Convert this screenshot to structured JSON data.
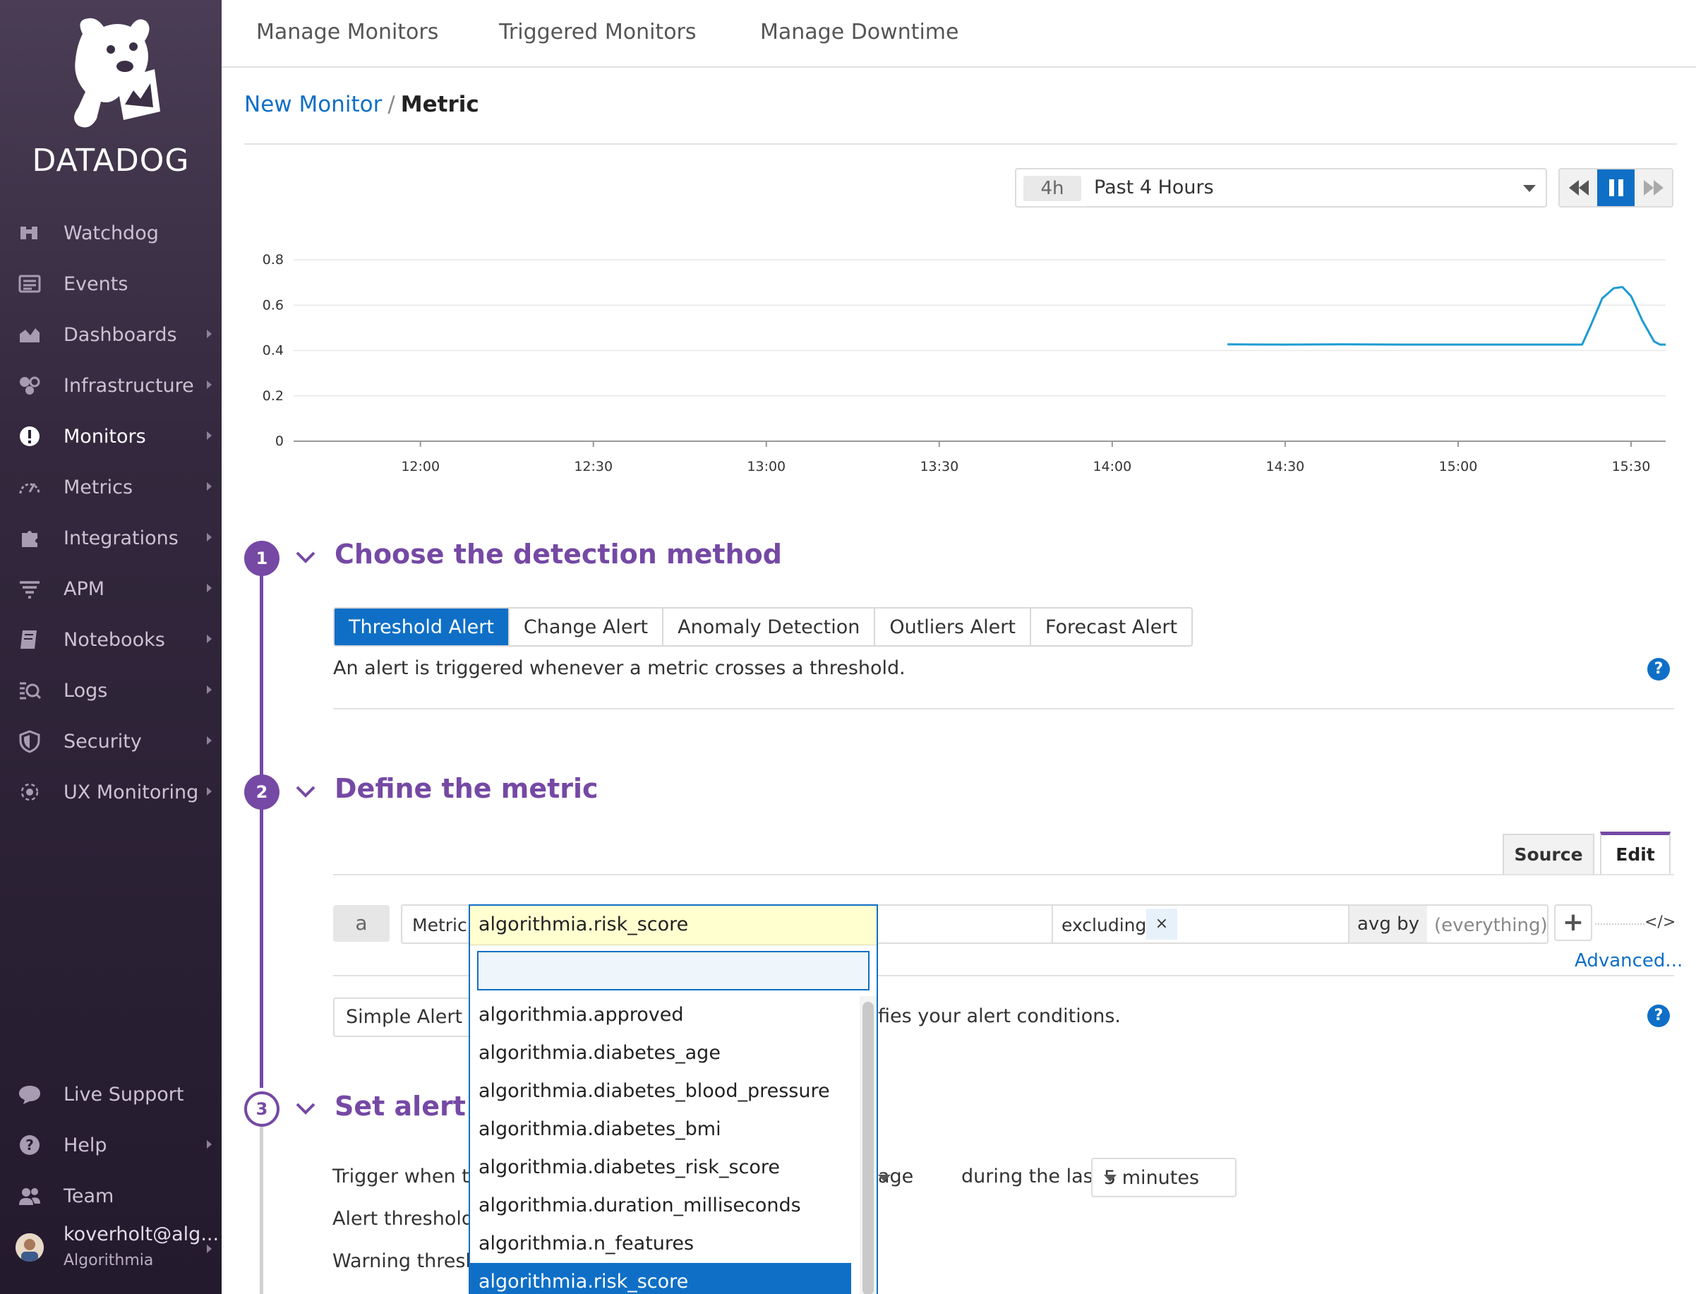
{
  "sidebar": {
    "logo_text": "DATADOG",
    "items": [
      {
        "label": "Watchdog",
        "icon": "binoculars-icon",
        "has_submenu": false,
        "active": false
      },
      {
        "label": "Events",
        "icon": "list-icon",
        "has_submenu": false,
        "active": false
      },
      {
        "label": "Dashboards",
        "icon": "area-chart-icon",
        "has_submenu": true,
        "active": false
      },
      {
        "label": "Infrastructure",
        "icon": "hexagons-icon",
        "has_submenu": true,
        "active": false
      },
      {
        "label": "Monitors",
        "icon": "exclamation-circle-icon",
        "has_submenu": true,
        "active": true
      },
      {
        "label": "Metrics",
        "icon": "gauge-icon",
        "has_submenu": true,
        "active": false
      },
      {
        "label": "Integrations",
        "icon": "puzzle-icon",
        "has_submenu": true,
        "active": false
      },
      {
        "label": "APM",
        "icon": "filter-lines-icon",
        "has_submenu": true,
        "active": false
      },
      {
        "label": "Notebooks",
        "icon": "notebook-icon",
        "has_submenu": true,
        "active": false
      },
      {
        "label": "Logs",
        "icon": "logs-search-icon",
        "has_submenu": true,
        "active": false
      },
      {
        "label": "Security",
        "icon": "shield-icon",
        "has_submenu": true,
        "active": false
      },
      {
        "label": "UX Monitoring",
        "icon": "radar-icon",
        "has_submenu": true,
        "active": false
      }
    ],
    "bottom_items": [
      {
        "label": "Live Support",
        "icon": "chat-bubble-icon",
        "has_submenu": false
      },
      {
        "label": "Help",
        "icon": "question-circle-icon",
        "has_submenu": true
      },
      {
        "label": "Team",
        "icon": "team-icon",
        "has_submenu": false
      }
    ],
    "user": {
      "name": "koverholt@alg...",
      "org": "Algorithmia"
    }
  },
  "topnav": {
    "tabs": [
      "Manage Monitors",
      "Triggered Monitors",
      "Manage Downtime"
    ]
  },
  "breadcrumb": {
    "parent": "New Monitor",
    "separator": "/",
    "current": "Metric"
  },
  "timeframe": {
    "short": "4h",
    "label": "Past 4 Hours"
  },
  "chart_data": {
    "type": "line",
    "title": "",
    "xlabel": "",
    "ylabel": "",
    "ylim": [
      0,
      0.8
    ],
    "y_ticks": [
      "0",
      "0.2",
      "0.4",
      "0.6",
      "0.8"
    ],
    "x_ticks": [
      "12:00",
      "12:30",
      "13:00",
      "13:30",
      "14:00",
      "14:30",
      "15:00",
      "15:30"
    ],
    "x_tick_minutes": [
      0,
      30,
      60,
      90,
      120,
      150,
      180,
      210
    ],
    "x_range_minutes": [
      -22,
      216
    ],
    "series": [
      {
        "color": "#1d9bd1",
        "points": [
          [
            140,
            0.427
          ],
          [
            150,
            0.426
          ],
          [
            160,
            0.427
          ],
          [
            170,
            0.426
          ],
          [
            180,
            0.426
          ],
          [
            190,
            0.426
          ],
          [
            200,
            0.426
          ],
          [
            201.5,
            0.426
          ],
          [
            203,
            0.51
          ],
          [
            205,
            0.63
          ],
          [
            207,
            0.675
          ],
          [
            208.5,
            0.68
          ],
          [
            210,
            0.64
          ],
          [
            212,
            0.53
          ],
          [
            214,
            0.44
          ],
          [
            215,
            0.426
          ],
          [
            216,
            0.426
          ]
        ]
      }
    ],
    "grid": true
  },
  "steps": [
    {
      "number": "1",
      "title": "Choose the detection method"
    },
    {
      "number": "2",
      "title": "Define the metric"
    },
    {
      "number": "3",
      "title": "Set alert co"
    }
  ],
  "detection": {
    "types": [
      "Threshold Alert",
      "Change Alert",
      "Anomaly Detection",
      "Outliers Alert",
      "Forecast Alert"
    ],
    "selected": "Threshold Alert",
    "description": "An alert is triggered whenever a metric crosses a threshold."
  },
  "metric_editor": {
    "tabs": {
      "source": "Source",
      "edit": "Edit"
    },
    "query_letter": "a",
    "metric_label": "Metric",
    "excluding_label": "excluding",
    "excluding_clear": "×",
    "avg_by_label": "avg by",
    "avg_by_placeholder": "(everything)",
    "add_label": "+",
    "code_label": "</>",
    "advanced_label": "Advanced...",
    "alert_type": "Simple Alert",
    "alert_type_desc_fragment": "fies your alert conditions."
  },
  "metric_dropdown": {
    "selected": "algorithmia.risk_score",
    "search_value": "",
    "options": [
      "algorithmia.approved",
      "algorithmia.diabetes_age",
      "algorithmia.diabetes_blood_pressure",
      "algorithmia.diabetes_bmi",
      "algorithmia.diabetes_risk_score",
      "algorithmia.duration_milliseconds",
      "algorithmia.n_features",
      "algorithmia.risk_score"
    ],
    "highlighted": "algorithmia.risk_score"
  },
  "alert_conditions": {
    "trigger_label": "Trigger when th",
    "aggregation_fragment": "age",
    "during_label": "during the last",
    "window": "5 minutes",
    "alert_threshold_label": "Alert threshold:",
    "warning_threshold_label": "Warning thresh"
  },
  "colors": {
    "accent_purple": "#7549a4",
    "link_blue": "#0f6fc6",
    "series_line": "#1d9bd1",
    "sidebar_bg": "#33283d"
  }
}
